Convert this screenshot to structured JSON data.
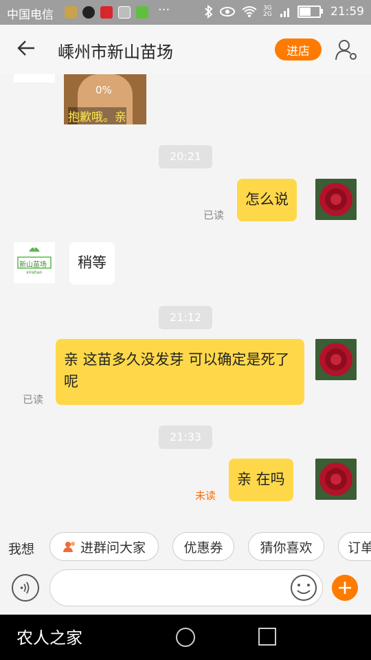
{
  "status_bar": {
    "carrier": "中国电信",
    "more_glyph": "···",
    "network": "3G 2G",
    "time": "21:59",
    "battery_level": 0.6
  },
  "header": {
    "title": "嵊州市新山苗场",
    "enter_shop_label": "进店"
  },
  "messages": {
    "image_caption": "抱歉哦。亲",
    "image_progress": "0%",
    "ts1": "20:21",
    "msg1": "怎么说",
    "msg1_status": "已读",
    "logo_text": "新山苗场",
    "logo_sub": "xinshan",
    "msg2": "稍等",
    "ts2": "21:12",
    "msg3": "亲   这苗多久没发芽 可以确定是死了呢",
    "msg3_status": "已读",
    "ts3": "21:33",
    "msg4": "亲  在吗",
    "msg4_status": "未读"
  },
  "suggestions": {
    "label": "我想",
    "chips": [
      "进群问大家",
      "优惠券",
      "猜你喜欢",
      "订单"
    ]
  },
  "colors": {
    "accent": "#ff7a00",
    "bubble_mine": "#ffd84a",
    "unread": "#ff6a00"
  },
  "navbar": {
    "watermark": "农人之家"
  }
}
